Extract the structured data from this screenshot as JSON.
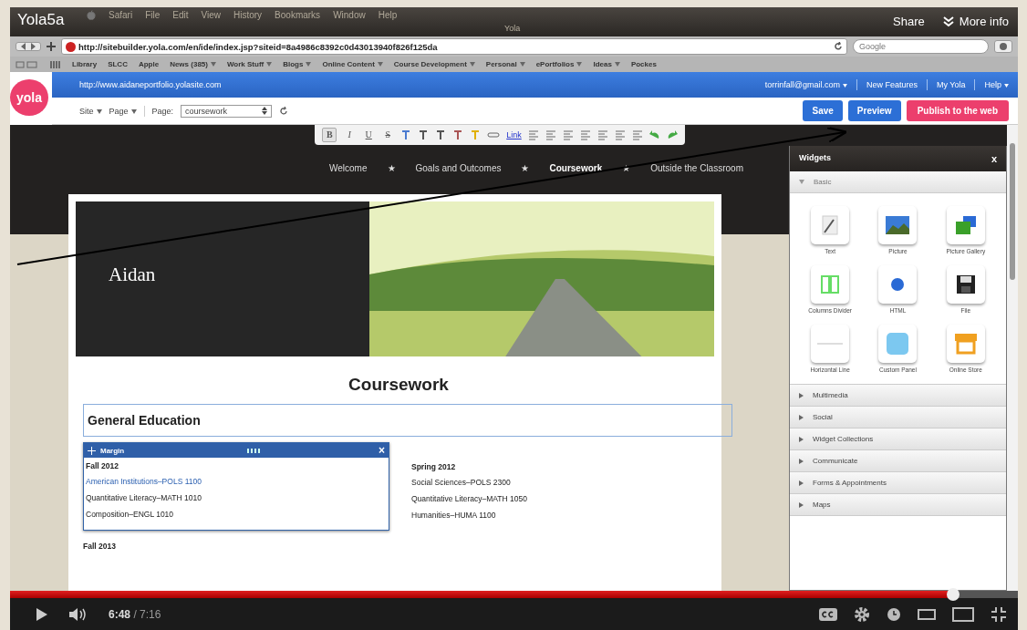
{
  "video": {
    "title": "Yola5a",
    "actions": [
      {
        "kind": "share",
        "label": "Share"
      },
      {
        "kind": "info",
        "label": "More info"
      }
    ]
  },
  "menubar": {
    "items": [
      "Safari",
      "File",
      "Edit",
      "View",
      "History",
      "Bookmarks",
      "Window",
      "Help"
    ],
    "window_title": "Yola"
  },
  "address_bar": {
    "url": "http://sitebuilder.yola.com/en/ide/index.jsp?siteid=8a4986c8392c0d43013940f826f125da",
    "search_placeholder": "Google"
  },
  "bookmarks": [
    {
      "label": "Library",
      "menu": false
    },
    {
      "label": "SLCC",
      "menu": false
    },
    {
      "label": "Apple",
      "menu": false
    },
    {
      "label": "News (385)",
      "menu": true
    },
    {
      "label": "Work Stuff",
      "menu": true
    },
    {
      "label": "Blogs",
      "menu": true
    },
    {
      "label": "Online Content",
      "menu": true
    },
    {
      "label": "Course Development",
      "menu": true
    },
    {
      "label": "Personal",
      "menu": true
    },
    {
      "label": "ePortfolios",
      "menu": true
    },
    {
      "label": "Ideas",
      "menu": true
    },
    {
      "label": "Pockes",
      "menu": false
    }
  ],
  "yola_bar": {
    "logo": "yola",
    "site_url": "http://www.aidaneportfolio.yolasite.com",
    "links": [
      {
        "label": "torrinfall@gmail.com",
        "menu": true
      },
      {
        "label": "New Features",
        "menu": false
      },
      {
        "label": "My Yola",
        "menu": false
      },
      {
        "label": "Help",
        "menu": true
      }
    ]
  },
  "editor_toolbar": {
    "menus": [
      "Site",
      "Page"
    ],
    "page_label": "Page:",
    "page_value": "coursework",
    "buttons": [
      {
        "kind": "save",
        "label": "Save"
      },
      {
        "kind": "preview",
        "label": "Preview"
      },
      {
        "kind": "publish",
        "label": "Publish to the web"
      }
    ]
  },
  "format_toolbar": {
    "letters": [
      "B",
      "I",
      "U",
      "S"
    ],
    "link_label": "Link"
  },
  "site_nav": [
    {
      "label": "Welcome",
      "selected": false
    },
    {
      "label": "Goals and Outcomes",
      "selected": false
    },
    {
      "label": "Coursework",
      "selected": true
    },
    {
      "label": "Outside the Classroom",
      "selected": false
    }
  ],
  "nav_separator": "★",
  "header": {
    "site_name": "Aidan"
  },
  "content": {
    "heading": "Coursework",
    "section_title": "General Education",
    "margin_widget": {
      "title": "Margin",
      "close": "×"
    },
    "columns": [
      {
        "term": "Fall 2012",
        "courses": [
          {
            "label": "American Institutions–POLS 1100",
            "highlighted": true
          },
          {
            "label": "Quantitative Literacy–MATH 1010",
            "highlighted": false
          },
          {
            "label": "Composition–ENGL 1010",
            "highlighted": false
          }
        ]
      },
      {
        "term": "Spring 2012",
        "courses": [
          {
            "label": "Social Sciences–POLS 2300",
            "highlighted": false
          },
          {
            "label": "Quantitative Literacy–MATH 1050",
            "highlighted": false
          },
          {
            "label": "Humanities–HUMA 1100",
            "highlighted": false
          }
        ]
      }
    ],
    "next_term": "Fall 2013"
  },
  "widgets_panel": {
    "title": "Widgets",
    "close": "x",
    "sections": [
      {
        "label": "Basic",
        "expanded": true,
        "widgets": [
          {
            "kind": "text",
            "label": "Text"
          },
          {
            "kind": "picture",
            "label": "Picture"
          },
          {
            "kind": "gallery",
            "label": "Picture Gallery"
          },
          {
            "kind": "columns",
            "label": "Columns Divider"
          },
          {
            "kind": "html",
            "label": "HTML"
          },
          {
            "kind": "file",
            "label": "File"
          },
          {
            "kind": "line",
            "label": "Horizontal Line"
          },
          {
            "kind": "panel",
            "label": "Custom Panel"
          },
          {
            "kind": "store",
            "label": "Online Store"
          }
        ]
      },
      {
        "label": "Multimedia",
        "expanded": false
      },
      {
        "label": "Social",
        "expanded": false
      },
      {
        "label": "Widget Collections",
        "expanded": false
      },
      {
        "label": "Communicate",
        "expanded": false
      },
      {
        "label": "Forms & Appointments",
        "expanded": false
      },
      {
        "label": "Maps",
        "expanded": false
      }
    ]
  },
  "player": {
    "level": 0.936,
    "current_time": "6:48",
    "duration": "/ 7:16"
  }
}
